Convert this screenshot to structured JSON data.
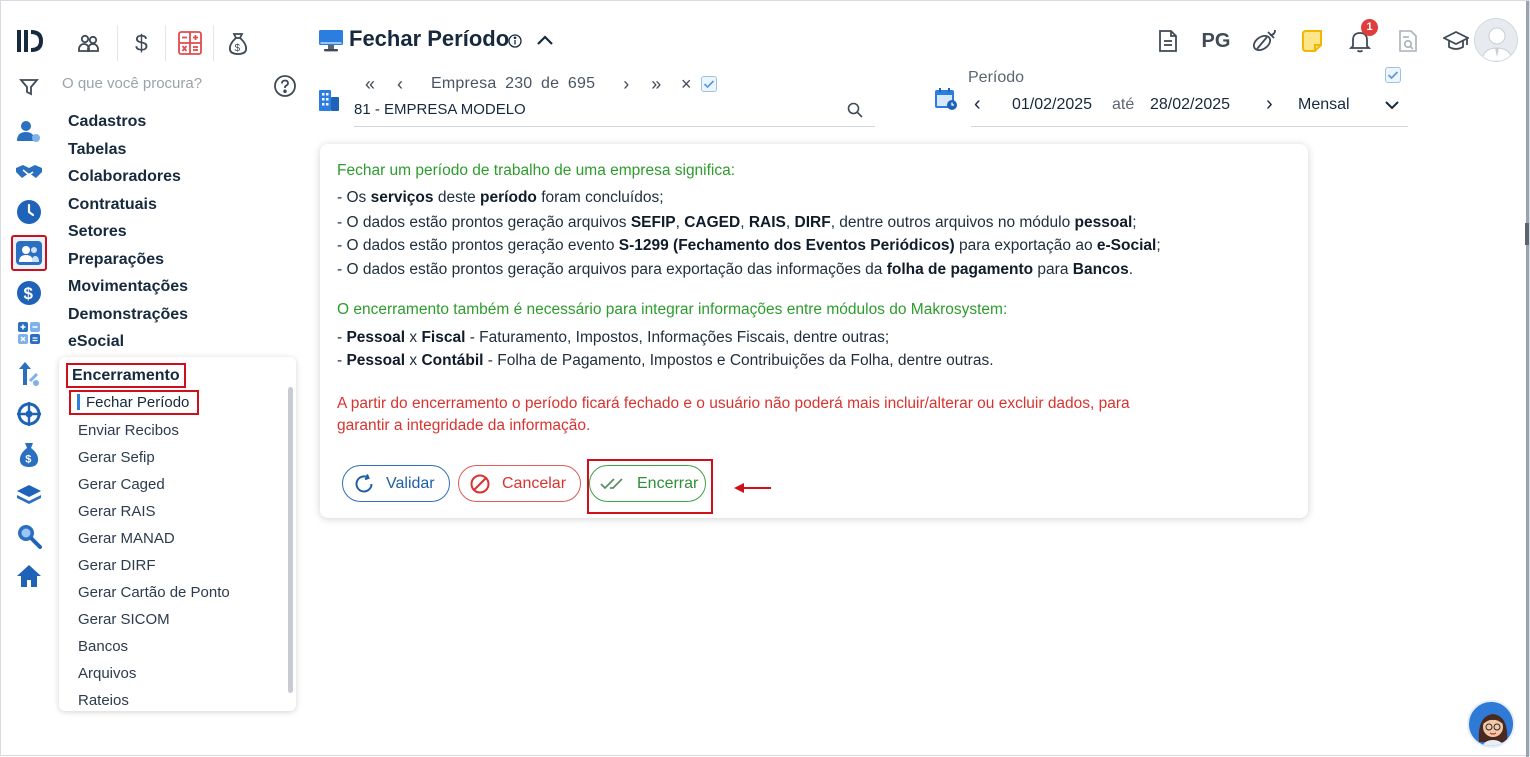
{
  "header": {
    "title": "Fechar Período",
    "pg_label": "PG",
    "notification_count": "1"
  },
  "search": {
    "placeholder": "O que você procura?"
  },
  "company": {
    "label": "Empresa",
    "index": "230",
    "of_label": "de",
    "total": "695",
    "value": "81 - EMPRESA MODELO"
  },
  "period": {
    "label": "Período",
    "start": "01/02/2025",
    "until_label": "até",
    "end": "28/02/2025",
    "frequency": "Mensal"
  },
  "menu": {
    "items": [
      "Cadastros",
      "Tabelas",
      "Colaboradores",
      "Contratuais",
      "Setores",
      "Preparações",
      "Movimentações",
      "Demonstrações",
      "eSocial"
    ],
    "section_title": "Encerramento",
    "sub_items": [
      "Fechar Período",
      "Enviar Recibos",
      "Gerar Sefip",
      "Gerar Caged",
      "Gerar RAIS",
      "Gerar MANAD",
      "Gerar DIRF",
      "Gerar Cartão de Ponto",
      "Gerar SICOM",
      "Bancos",
      "Arquivos",
      "Rateios"
    ]
  },
  "content": {
    "intro_heading": "Fechar um período de trabalho de uma empresa significa:",
    "l1": {
      "a": "- Os ",
      "b": "serviços",
      "c": " deste ",
      "d": "período",
      "e": " foram concluídos;"
    },
    "l2": {
      "a": "- O dados estão prontos geração arquivos ",
      "b": "SEFIP",
      "c": ", ",
      "d": "CAGED",
      "e": ", ",
      "f": "RAIS",
      "g": ", ",
      "h": "DIRF",
      "i": ", dentre outros arquivos no módulo ",
      "j": "pessoal",
      "k": ";"
    },
    "l3": {
      "a": "- O dados estão prontos geração evento ",
      "b": "S-1299 (Fechamento dos Eventos Periódicos)",
      "c": " para exportação ao ",
      "d": "e-Social",
      "e": ";"
    },
    "l4": {
      "a": "- O dados estão prontos geração arquivos para exportação das informações da ",
      "b": "folha de pagamento",
      "c": " para ",
      "d": "Bancos",
      "e": "."
    },
    "integration_heading": "O encerramento também é necessário para integrar informações entre módulos do Makrosystem:",
    "l5": {
      "a": "- ",
      "b": "Pessoal",
      "c": " x ",
      "d": "Fiscal",
      "e": " - Faturamento, Impostos, Informações Fiscais, dentre outras;"
    },
    "l6": {
      "a": "- ",
      "b": "Pessoal",
      "c": " x ",
      "d": "Contábil",
      "e": " - Folha de Pagamento, Impostos e Contribuições da Folha, dentre outras."
    },
    "warning_line1": "A partir do encerramento o período ficará fechado e o usuário não poderá mais incluir/alterar ou excluir dados, para",
    "warning_line2": "garantir a integridade da informação."
  },
  "buttons": {
    "validar": "Validar",
    "cancelar": "Cancelar",
    "encerrar": "Encerrar"
  },
  "colors": {
    "accent_blue": "#2f6fb7",
    "success_green": "#2d9c2d",
    "danger_red": "#d8332f",
    "highlight_red": "#d00f1a"
  }
}
